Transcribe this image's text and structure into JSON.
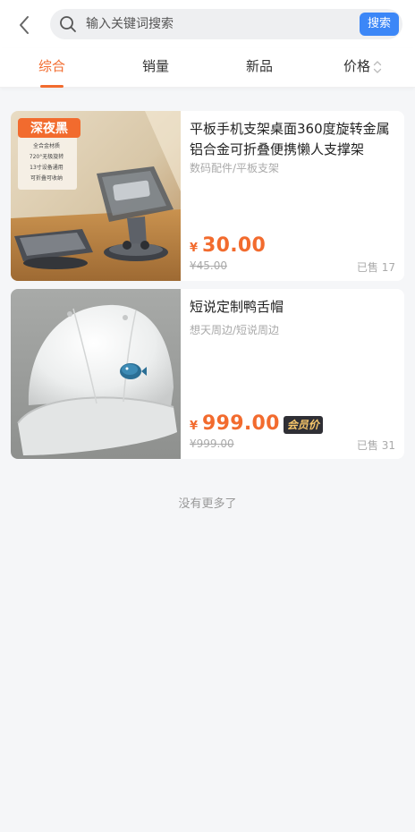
{
  "header": {
    "search_placeholder": "输入关键词搜索",
    "search_button": "搜索",
    "icons": {
      "back": "chevron-left-icon",
      "search": "search-icon"
    }
  },
  "tabs": [
    {
      "label": "综合",
      "active": true
    },
    {
      "label": "销量",
      "active": false
    },
    {
      "label": "新品",
      "active": false
    },
    {
      "label": "价格",
      "active": false,
      "sortable": true
    }
  ],
  "products": [
    {
      "title": "平板手机支架桌面360度旋转金属铝合金可折叠便携懒人支撑架",
      "category": "数码配件/平板支架",
      "currency": "¥",
      "price": "30.00",
      "original_price": "¥45.00",
      "sold": "已售 17",
      "image": {
        "badge": "深夜黑",
        "features": [
          "全合金材质",
          "720°无极旋转",
          "13寸设备通用",
          "可折叠可收纳"
        ]
      }
    },
    {
      "title": "短说定制鸭舌帽",
      "category": "想天周边/短说周边",
      "currency": "¥",
      "price": "999.00",
      "vip_badge": "会员价",
      "original_price": "¥999.00",
      "sold": "已售 31"
    }
  ],
  "footer": {
    "no_more": "没有更多了"
  },
  "colors": {
    "accent": "#f26b2e",
    "primary": "#3c87f7",
    "background": "#f5f6f8"
  }
}
